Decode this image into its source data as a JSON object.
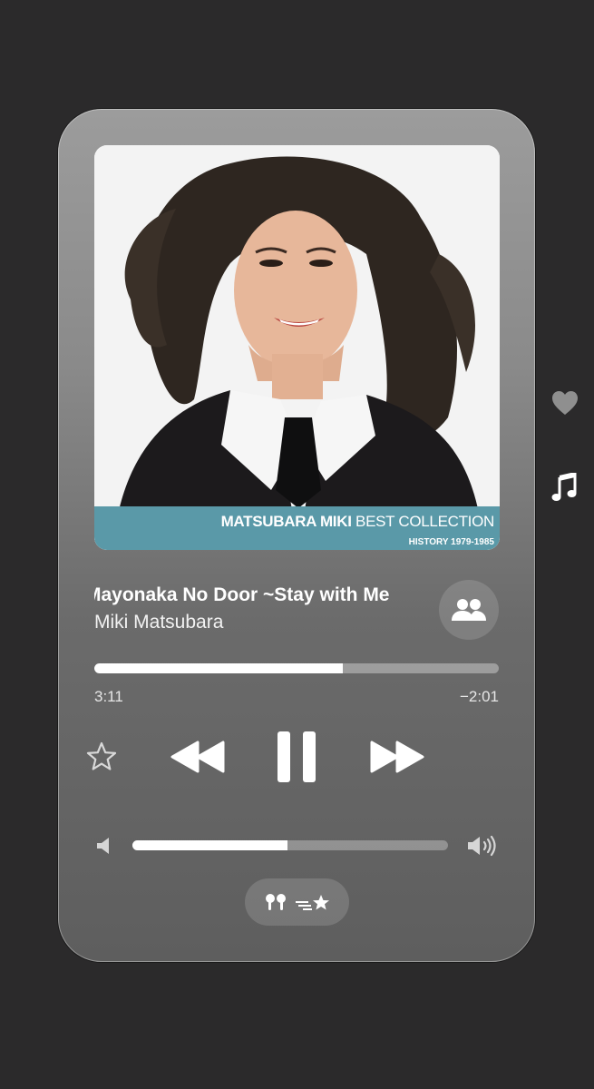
{
  "album": {
    "title_bold": "MATSUBARA MIKI",
    "title_rest": " BEST COLLECTION",
    "subtitle": "HISTORY 1979-1985"
  },
  "track": {
    "title": "Mayonaka No Door ~Stay with Me",
    "artist": "Miki Matsubara"
  },
  "progress": {
    "elapsed": "3:11",
    "remaining": "−2:01",
    "fraction": 0.614
  },
  "volume": {
    "fraction": 0.49
  },
  "output": {
    "label": "🎧"
  },
  "icons": {
    "share": "shareplay-people-icon",
    "favorite": "star-icon",
    "rewind": "rewind-icon",
    "pause": "pause-icon",
    "forward": "fast-forward-icon",
    "volume_low": "speaker-low-icon",
    "volume_high": "speaker-high-icon",
    "airpods": "airpods-icon",
    "dolby": "dolby-atmos-icon",
    "side_heart": "heart-icon",
    "side_note": "music-note-icon"
  },
  "colors": {
    "background": "#2b2a2b",
    "band": "#5a99a8",
    "accent": "#ffffff"
  }
}
